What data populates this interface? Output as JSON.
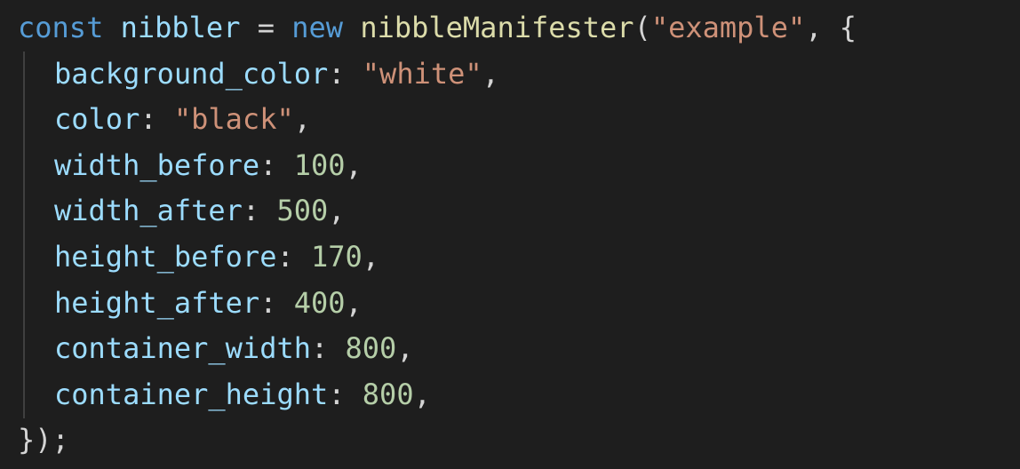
{
  "code": {
    "line1": {
      "keyword_const": "const",
      "var_name": "nibbler",
      "op_assign": "=",
      "keyword_new": "new",
      "fn_name": "nibbleManifester",
      "open_paren": "(",
      "arg_string": "\"example\"",
      "comma_brace": ", {"
    },
    "properties": [
      {
        "key": "background_color",
        "value": "\"white\"",
        "type": "string"
      },
      {
        "key": "color",
        "value": "\"black\"",
        "type": "string"
      },
      {
        "key": "width_before",
        "value": "100",
        "type": "number"
      },
      {
        "key": "width_after",
        "value": "500",
        "type": "number"
      },
      {
        "key": "height_before",
        "value": "170",
        "type": "number"
      },
      {
        "key": "height_after",
        "value": "400",
        "type": "number"
      },
      {
        "key": "container_width",
        "value": "800",
        "type": "number"
      },
      {
        "key": "container_height",
        "value": "800",
        "type": "number"
      }
    ],
    "closing": "});"
  },
  "colors": {
    "background": "#1e1e1e",
    "keyword": "#569cd6",
    "variable": "#9cdcfe",
    "function": "#dcdcaa",
    "string": "#ce9178",
    "number": "#b5cea8",
    "punctuation": "#d4d4d4"
  }
}
